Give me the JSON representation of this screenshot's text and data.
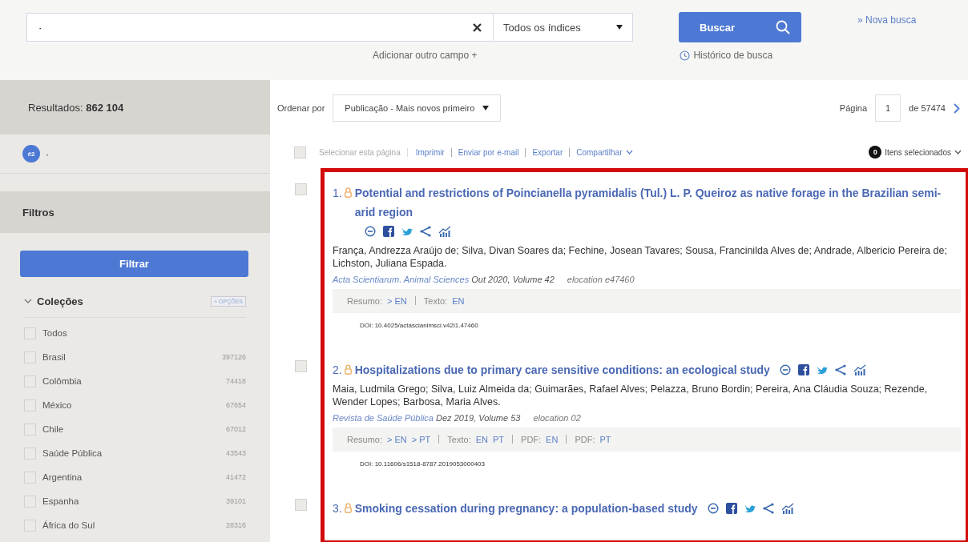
{
  "search": {
    "value": "·",
    "index_select": "Todos os índices",
    "button": "Buscar",
    "new_search": "» Nova busca",
    "add_field": "Adicionar outro campo +",
    "history": "Histórico de busca"
  },
  "sidebar": {
    "results_label": "Resultados:",
    "results_count": "862 104",
    "query_badge": "#2",
    "query": "·",
    "filters_title": "Filtros",
    "filter_button": "Filtrar",
    "collections": {
      "title": "Coleções",
      "expanded": true,
      "options_button": "+ OPÇÕES",
      "items": [
        {
          "label": "Todos",
          "checked": false
        },
        {
          "label": "Brasil",
          "count": "397126",
          "checked": false
        },
        {
          "label": "Colômbia",
          "count": "74418",
          "checked": false
        },
        {
          "label": "México",
          "count": "67654",
          "checked": false
        },
        {
          "label": "Chile",
          "count": "67012",
          "checked": false
        },
        {
          "label": "Saúde Pública",
          "count": "43543",
          "checked": false
        },
        {
          "label": "Argentina",
          "count": "41472",
          "checked": false
        },
        {
          "label": "Espanha",
          "count": "39101",
          "checked": false
        },
        {
          "label": "África do Sul",
          "count": "28316",
          "checked": false
        }
      ]
    }
  },
  "toolbar": {
    "sort_label": "Ordenar por",
    "sort_value": "Publicação - Mais novos primeiro",
    "page_label": "Página",
    "page": "1",
    "page_total": "de 57474",
    "select_page": "Selecionar esta página",
    "select_page_checked": false,
    "actions": [
      "Imprimir",
      "Enviar por e-mail",
      "Exportar",
      "Compartilhar"
    ],
    "selected_count": "0",
    "selected_label": "Itens selecionados"
  },
  "results": [
    {
      "number": "1.",
      "title": "Potential and restrictions of Poincianella pyramidalis (Tul.) L. P. Queiroz as native forage in the Brazilian semi-arid region",
      "checked": false,
      "authors": "França, Andrezza Araújo de; Silva, Divan Soares da; Fechine, Josean Tavares; Sousa, Francinilda Alves de; Andrade, Albericio Pereira de; Lichston, Juliana Espada.",
      "journal": "Acta Scientiarum. Animal Sciences",
      "date": "Out 2020,",
      "volume": "Volume 42",
      "elocation": "elocation e47460",
      "links": [
        {
          "label": "Resumo:",
          "items": [
            "> EN"
          ]
        },
        {
          "label": "Texto:",
          "items": [
            "EN"
          ]
        }
      ],
      "doi": "DOI: 10.4025/actascianimsci.v42i1.47460"
    },
    {
      "number": "2.",
      "title": "Hospitalizations due to primary care sensitive conditions: an ecological study",
      "checked": false,
      "authors": "Maia, Ludmila Grego; Silva, Luiz Almeida da; Guimarães, Rafael Alves; Pelazza, Bruno Bordin; Pereira, Ana Cláudia Souza; Rezende, Wender Lopes; Barbosa, Maria Alves.",
      "journal": "Revista de Saúde Pública",
      "date": "Dez 2019,",
      "volume": "Volume 53",
      "elocation": "elocation 02",
      "links": [
        {
          "label": "Resumo:",
          "items": [
            "> EN",
            "> PT"
          ]
        },
        {
          "label": "Texto:",
          "items": [
            "EN",
            "PT"
          ]
        },
        {
          "label": "PDF:",
          "items": [
            "EN"
          ]
        },
        {
          "label": "PDF:",
          "items": [
            "PT"
          ]
        }
      ],
      "doi": "DOI: 10.11606/s1518-8787.2019053000403"
    },
    {
      "number": "3.",
      "title": "Smoking cessation during pregnancy: a population-based study",
      "checked": false
    }
  ]
}
